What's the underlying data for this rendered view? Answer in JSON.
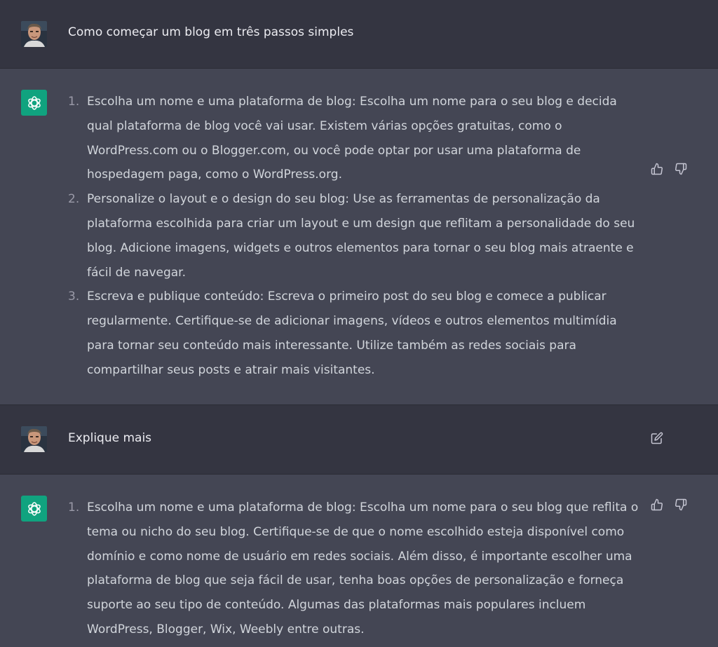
{
  "conversation": [
    {
      "role": "user",
      "text": "Como começar um blog em três passos simples"
    },
    {
      "role": "assistant",
      "items": [
        {
          "num": "1.",
          "text": "Escolha um nome e uma plataforma de blog: Escolha um nome para o seu blog e decida qual plataforma de blog você vai usar. Existem várias opções gratuitas, como o WordPress.com ou o Blogger.com, ou você pode optar por usar uma plataforma de hospedagem paga, como o WordPress.org."
        },
        {
          "num": "2.",
          "text": "Personalize o layout e o design do seu blog: Use as ferramentas de personalização da plataforma escolhida para criar um layout e um design que reflitam a personalidade do seu blog. Adicione imagens, widgets e outros elementos para tornar o seu blog mais atraente e fácil de navegar."
        },
        {
          "num": "3.",
          "text": "Escreva e publique conteúdo: Escreva o primeiro post do seu blog e comece a publicar regularmente. Certifique-se de adicionar imagens, vídeos e outros elementos multimídia para tornar seu conteúdo mais interessante. Utilize também as redes sociais para compartilhar seus posts e atrair mais visitantes."
        }
      ]
    },
    {
      "role": "user",
      "text": "Explique mais"
    },
    {
      "role": "assistant",
      "items": [
        {
          "num": "1.",
          "text": "Escolha um nome e uma plataforma de blog: Escolha um nome para o seu blog que reflita o tema ou nicho do seu blog. Certifique-se de que o nome escolhido esteja disponível como domínio e como nome de usuário em redes sociais. Além disso, é importante escolher uma plataforma de blog que seja fácil de usar, tenha boas opções de personalização e forneça suporte ao seu tipo de conteúdo. Algumas das plataformas mais populares incluem WordPress, Blogger, Wix, Weebly entre outras."
        }
      ]
    }
  ],
  "icons": {
    "user_avatar": "user-avatar-photo",
    "assistant_logo": "openai-logo-icon",
    "like": "thumbs-up-icon",
    "dislike": "thumbs-down-icon",
    "edit": "edit-message-icon"
  },
  "colors": {
    "user_row_bg": "#343541",
    "assistant_row_bg": "#444654",
    "assistant_logo_bg": "#10a37f",
    "user_text": "#ececf1",
    "assistant_text": "#d1d5db",
    "icon": "#c5c5d2"
  }
}
